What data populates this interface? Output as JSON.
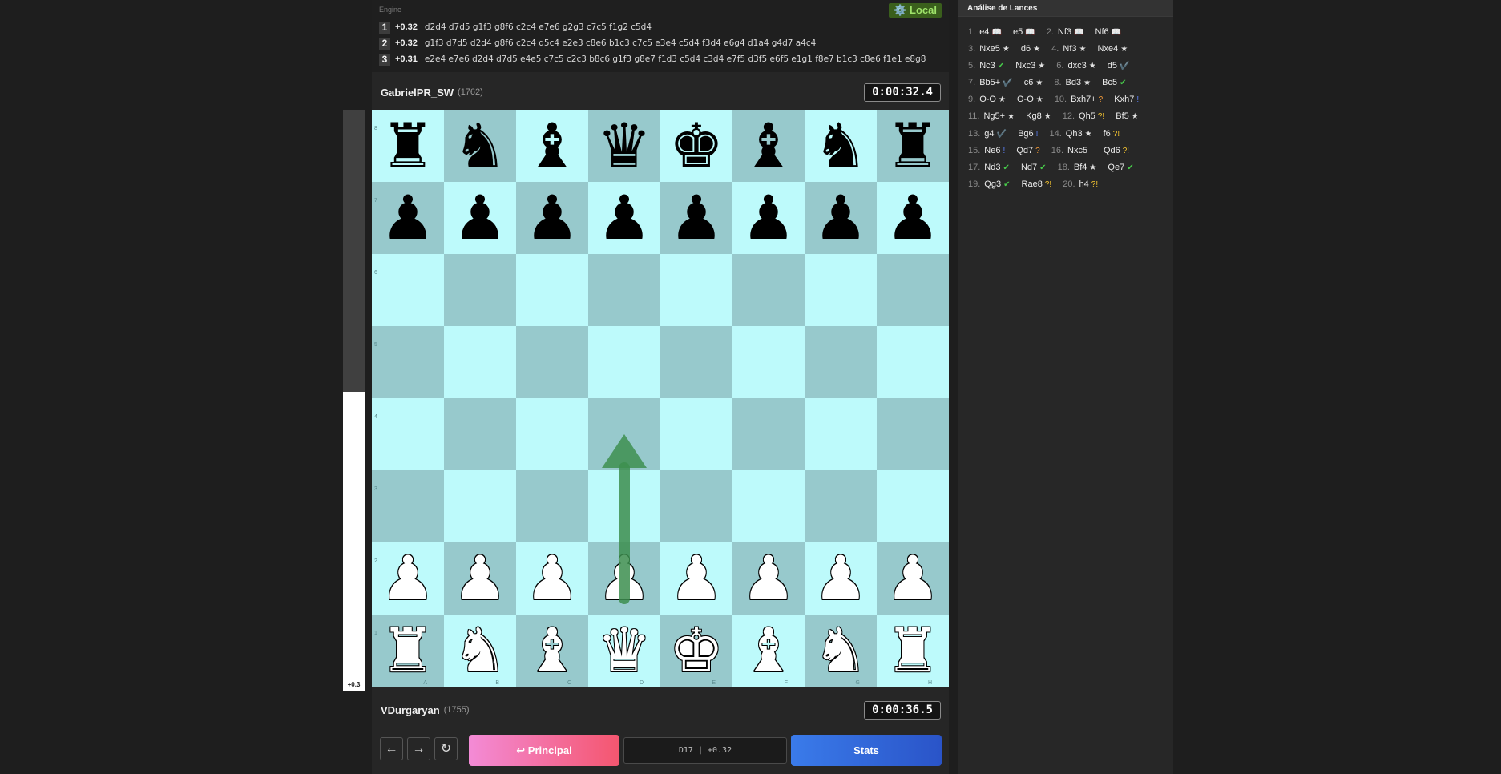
{
  "engine": {
    "title": "Engine",
    "badge": "⚙️ Local",
    "lines": [
      {
        "rank": "1",
        "score": "+0.32",
        "moves": "d2d4 d7d5 g1f3 g8f6 c2c4 e7e6 g2g3 c7c5 f1g2 c5d4"
      },
      {
        "rank": "2",
        "score": "+0.32",
        "moves": "g1f3 d7d5 d2d4 g8f6 c2c4 d5c4 e2e3 c8e6 b1c3 c7c5 e3e4 c5d4 f3d4 e6g4 d1a4 g4d7 a4c4"
      },
      {
        "rank": "3",
        "score": "+0.31",
        "moves": "e2e4 e7e6 d2d4 d7d5 e4e5 c7c5 c2c3 b8c6 g1f3 g8e7 f1d3 c5d4 c3d4 e7f5 d3f5 e6f5 e1g1 f8e7 b1c3 c8e6 f1e1 e8g8"
      }
    ]
  },
  "top_player": {
    "name": "GabrielPR_SW",
    "elo": "(1762)",
    "clock": "0:00:32.4"
  },
  "bottom_player": {
    "name": "VDurgaryan",
    "elo": "(1755)",
    "clock": "0:00:36.5"
  },
  "eval": {
    "label": "+0.3",
    "white_fraction": 0.515
  },
  "board": {
    "ranks": [
      "1",
      "2",
      "3",
      "4",
      "5",
      "6",
      "7",
      "8"
    ],
    "files": [
      "A",
      "B",
      "C",
      "D",
      "E",
      "F",
      "G",
      "H"
    ],
    "rows": [
      [
        "br",
        "bn",
        "bb",
        "bq",
        "bk",
        "bb",
        "bn",
        "br"
      ],
      [
        "bp",
        "bp",
        "bp",
        "bp",
        "bp",
        "bp",
        "bp",
        "bp"
      ],
      [
        "",
        "",
        "",
        "",
        "",
        "",
        "",
        ""
      ],
      [
        "",
        "",
        "",
        "",
        "",
        "",
        "",
        ""
      ],
      [
        "",
        "",
        "",
        "",
        "",
        "",
        "",
        ""
      ],
      [
        "",
        "",
        "",
        "",
        "",
        "",
        "",
        ""
      ],
      [
        "wp",
        "wp",
        "wp",
        "wp",
        "wp",
        "wp",
        "wp",
        "wp"
      ],
      [
        "wr",
        "wn",
        "wb",
        "wq",
        "wk",
        "wb",
        "wn",
        "wr"
      ]
    ],
    "arrow": {
      "from": "d2",
      "to": "d4",
      "color": "#3d8f4f"
    }
  },
  "controls": {
    "back": "←",
    "forward": "→",
    "reset": "↻",
    "principal": "↩ Principal",
    "opening": "D17 | +0.32",
    "stats": "Stats"
  },
  "analysis": {
    "title": "Análise de Lances",
    "moves": [
      {
        "n": "1.",
        "w": "e4",
        "ws": "book",
        "b": "e5",
        "bs": "book"
      },
      {
        "n": "2.",
        "w": "Nf3",
        "ws": "book",
        "b": "Nf6",
        "bs": "book"
      },
      {
        "n": "3.",
        "w": "Nxe5",
        "ws": "best",
        "b": "d6",
        "bs": "best"
      },
      {
        "n": "4.",
        "w": "Nf3",
        "ws": "best",
        "b": "Nxe4",
        "bs": "best"
      },
      {
        "n": "5.",
        "w": "Nc3",
        "ws": "good",
        "b": "Nxc3",
        "bs": "best"
      },
      {
        "n": "6.",
        "w": "dxc3",
        "ws": "best",
        "b": "d5",
        "bs": "ok"
      },
      {
        "n": "7.",
        "w": "Bb5+",
        "ws": "ok",
        "b": "c6",
        "bs": "best"
      },
      {
        "n": "8.",
        "w": "Bd3",
        "ws": "best",
        "b": "Bc5",
        "bs": "good"
      },
      {
        "n": "9.",
        "w": "O-O",
        "ws": "best",
        "b": "O-O",
        "bs": "best"
      },
      {
        "n": "10.",
        "w": "Bxh7+",
        "ws": "mis",
        "b": "Kxh7",
        "bs": "blu"
      },
      {
        "n": "11.",
        "w": "Ng5+",
        "ws": "best",
        "b": "Kg8",
        "bs": "best"
      },
      {
        "n": "12.",
        "w": "Qh5",
        "ws": "dub",
        "b": "Bf5",
        "bs": "best"
      },
      {
        "n": "13.",
        "w": "g4",
        "ws": "ok",
        "b": "Bg6",
        "bs": "blu"
      },
      {
        "n": "14.",
        "w": "Qh3",
        "ws": "best",
        "b": "f6",
        "bs": "dub"
      },
      {
        "n": "15.",
        "w": "Ne6",
        "ws": "blu",
        "b": "Qd7",
        "bs": "mis"
      },
      {
        "n": "16.",
        "w": "Nxc5",
        "ws": "blu",
        "b": "Qd6",
        "bs": "dub"
      },
      {
        "n": "17.",
        "w": "Nd3",
        "ws": "good",
        "b": "Nd7",
        "bs": "good"
      },
      {
        "n": "18.",
        "w": "Bf4",
        "ws": "best",
        "b": "Qe7",
        "bs": "good"
      },
      {
        "n": "19.",
        "w": "Qg3",
        "ws": "good",
        "b": "Rae8",
        "bs": "dub"
      },
      {
        "n": "20.",
        "w": "h4",
        "ws": "dub",
        "b": "",
        "bs": ""
      }
    ],
    "symbols": {
      "book": "📖",
      "best": "★",
      "good": "✔",
      "ok": "✔️",
      "dub": "?!",
      "mis": "?",
      "blu": "!"
    }
  }
}
